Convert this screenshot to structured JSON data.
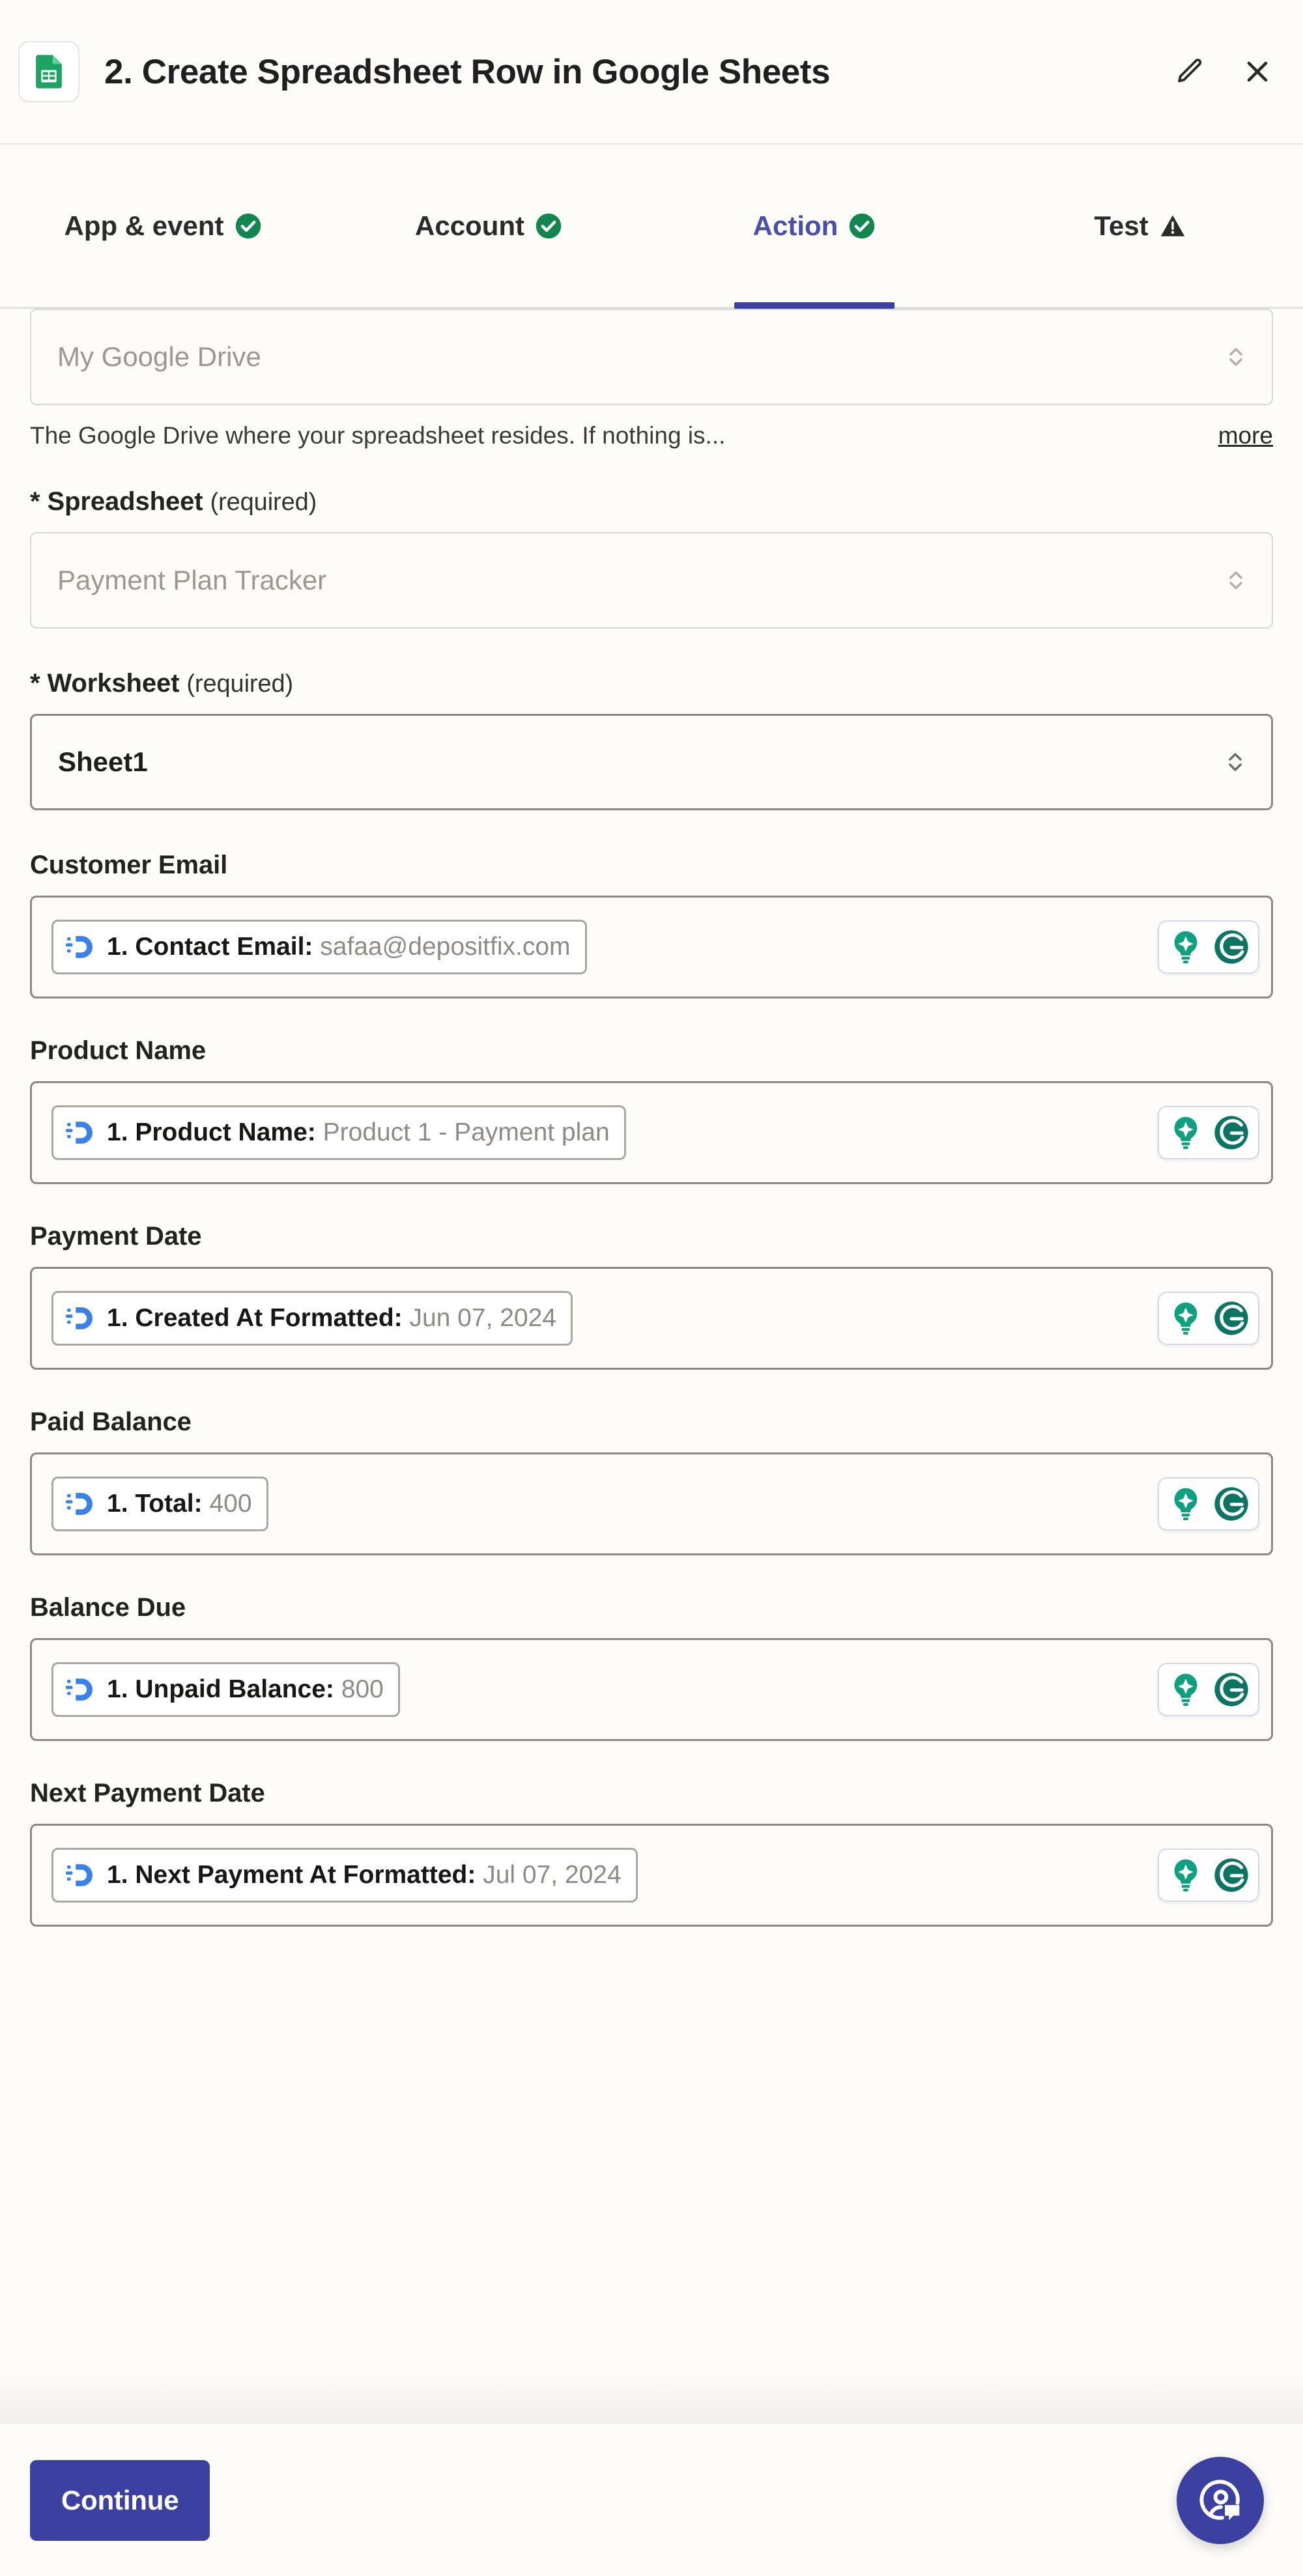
{
  "header": {
    "app_icon": "google-sheets-icon",
    "title": "2. Create Spreadsheet Row in Google Sheets",
    "edit_icon": "pencil-icon",
    "close_icon": "close-icon"
  },
  "tabs": [
    {
      "label": "App & event",
      "status": "complete",
      "status_icon": "check-circle-icon",
      "active": false
    },
    {
      "label": "Account",
      "status": "complete",
      "status_icon": "check-circle-icon",
      "active": false
    },
    {
      "label": "Action",
      "status": "complete",
      "status_icon": "check-circle-icon",
      "active": true
    },
    {
      "label": "Test",
      "status": "warning",
      "status_icon": "warning-triangle-icon",
      "active": false
    }
  ],
  "form": {
    "drive": {
      "value": "My Google Drive",
      "filled": false,
      "help_text": "The Google Drive where your spreadsheet resides. If nothing is...",
      "more_label": "more",
      "chevron_icon": "chevron-updown-icon"
    },
    "spreadsheet": {
      "label_star": "*",
      "label": "Spreadsheet",
      "required_note": "(required)",
      "value": "Payment Plan Tracker",
      "filled": false,
      "chevron_icon": "chevron-updown-icon"
    },
    "worksheet": {
      "label_star": "*",
      "label": "Worksheet",
      "required_note": "(required)",
      "value": "Sheet1",
      "filled": true,
      "chevron_icon": "chevron-updown-icon"
    },
    "token_fields": [
      {
        "label": "Customer Email",
        "token_logo": "depositfix-icon",
        "token_name": "1. Contact Email:",
        "token_value": "safaa@depositfix.com",
        "addons": [
          "zapier-ai-bulb-icon",
          "grammarly-icon"
        ]
      },
      {
        "label": "Product Name",
        "token_logo": "depositfix-icon",
        "token_name": "1. Product Name:",
        "token_value": "Product 1 - Payment plan",
        "addons": [
          "zapier-ai-bulb-icon",
          "grammarly-icon"
        ]
      },
      {
        "label": "Payment Date",
        "token_logo": "depositfix-icon",
        "token_name": "1. Created At Formatted:",
        "token_value": "Jun 07, 2024",
        "addons": [
          "zapier-ai-bulb-icon",
          "grammarly-icon"
        ]
      },
      {
        "label": "Paid Balance",
        "token_logo": "depositfix-icon",
        "token_name": "1. Total:",
        "token_value": "400",
        "addons": [
          "zapier-ai-bulb-icon",
          "grammarly-icon"
        ]
      },
      {
        "label": "Balance Due",
        "token_logo": "depositfix-icon",
        "token_name": "1. Unpaid Balance:",
        "token_value": "800",
        "addons": [
          "zapier-ai-bulb-icon",
          "grammarly-icon"
        ]
      },
      {
        "label": "Next Payment Date",
        "token_logo": "depositfix-icon",
        "token_name": "1. Next Payment At Formatted:",
        "token_value": "Jul 07, 2024",
        "addons": [
          "zapier-ai-bulb-icon",
          "grammarly-icon"
        ]
      }
    ]
  },
  "footer": {
    "continue_label": "Continue",
    "help_fab_icon": "support-chat-icon"
  },
  "colors": {
    "accent": "#3C40A0",
    "accent_text": "#4A4FA8",
    "background": "#FDFCF8",
    "check_green": "#11874F",
    "grammarly_green": "#0C7462",
    "bulb_green": "#0EA07F",
    "token_blue": "#3B82E8",
    "sheets_green": "#1DA462"
  }
}
